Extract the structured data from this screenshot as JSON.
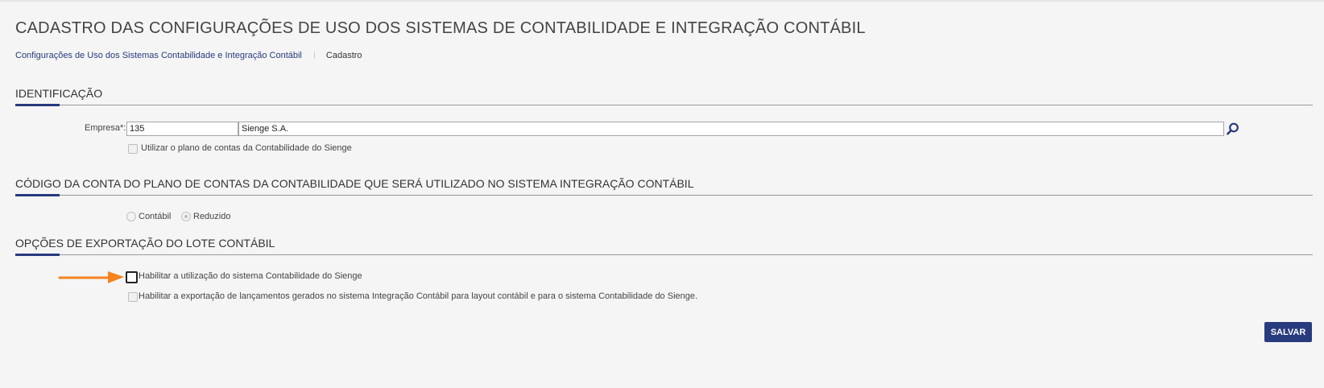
{
  "page": {
    "title": "CADASTRO DAS CONFIGURAÇÕES DE USO DOS SISTEMAS DE CONTABILIDADE E INTEGRAÇÃO CONTÁBIL"
  },
  "breadcrumb": {
    "link": "Configurações de Uso dos Sistemas Contabilidade e Integração Contábil",
    "current": "Cadastro"
  },
  "identificacao": {
    "heading": "IDENTIFICAÇÃO",
    "empresa_label": "Empresa*:",
    "empresa_code": "135",
    "empresa_name": "Sienge S.A.",
    "plano_contas_label": "Utilizar o plano de contas da Contabilidade do Sienge",
    "plano_contas_checked": false
  },
  "codigo_conta": {
    "heading": "CÓDIGO DA CONTA DO PLANO DE CONTAS DA CONTABILIDADE QUE SERÁ UTILIZADO NO SISTEMA INTEGRAÇÃO CONTÁBIL",
    "options": [
      "Contábil",
      "Reduzido"
    ],
    "selected": "Reduzido"
  },
  "exportacao": {
    "heading": "OPÇÕES DE EXPORTAÇÃO DO LOTE CONTÁBIL",
    "habilitar_contabilidade_label": "Habilitar a utilização do sistema Contabilidade do Sienge",
    "habilitar_contabilidade_checked": false,
    "habilitar_exportacao_label": "Habilitar a exportação de lançamentos gerados no sistema Integração Contábil para layout contábil e para o sistema Contabilidade do Sienge.",
    "habilitar_exportacao_checked": false
  },
  "actions": {
    "save_label": "SALVAR"
  },
  "icons": {
    "search": "search-icon",
    "annotation": "arrow-right-icon"
  },
  "colors": {
    "brand": "#283b7e",
    "annotation_arrow": "#f5841f",
    "background": "#f5f5f5"
  }
}
